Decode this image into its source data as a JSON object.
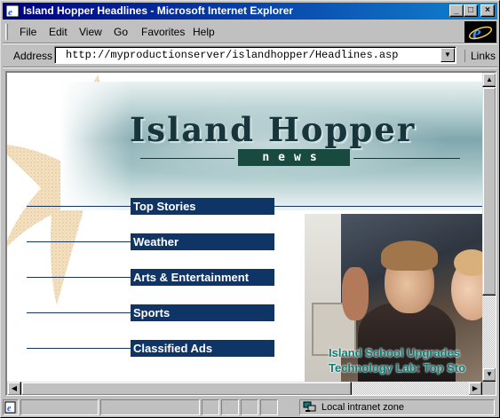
{
  "window": {
    "title": "Island Hopper Headlines - Microsoft Internet Explorer",
    "controls": {
      "minimize": "_",
      "maximize": "□",
      "close": "×"
    }
  },
  "menu": {
    "items": [
      "File",
      "Edit",
      "View",
      "Go",
      "Favorites",
      "Help"
    ]
  },
  "address": {
    "label": "Address",
    "url": "http://myproductionserver/islandhopper/Headlines.asp",
    "links_label": "Links"
  },
  "page": {
    "banner_title": "Island Hopper",
    "banner_subtitle": "news",
    "nav": [
      "Top Stories",
      "Weather",
      "Arts & Entertainment",
      "Sports",
      "Classified Ads"
    ],
    "headline_lines": [
      "Island School Upgrades",
      "Technology Lab: Top Sto"
    ]
  },
  "status": {
    "zone": "Local intranet zone"
  },
  "colors": {
    "titlebar_start": "#000080",
    "titlebar_end": "#1084d0",
    "nav_button": "#0f3566",
    "headline": "#127a72",
    "news_badge": "#184a40"
  }
}
